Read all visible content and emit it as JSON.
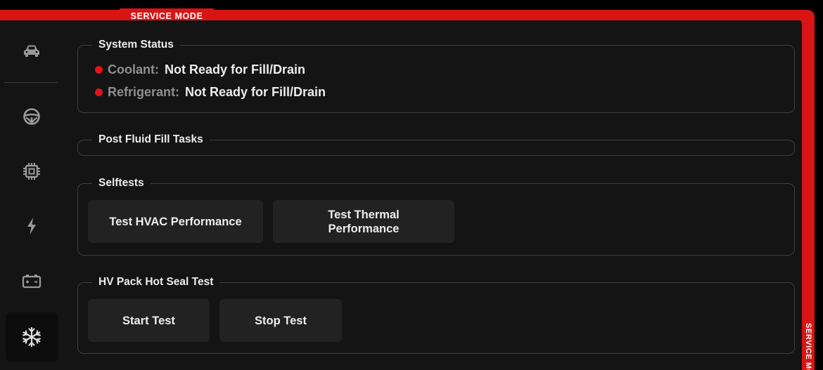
{
  "header": {
    "service_mode_label": "SERVICE MODE",
    "vertical_label": "SERVICE MODE"
  },
  "sidebar": {
    "items": [
      {
        "icon": "car-icon"
      },
      {
        "icon": "steering-wheel-icon"
      },
      {
        "icon": "chip-icon"
      },
      {
        "icon": "lightning-bolt-icon"
      },
      {
        "icon": "battery-icon"
      },
      {
        "icon": "snowflake-icon",
        "active": true
      }
    ]
  },
  "system_status": {
    "title": "System Status",
    "rows": [
      {
        "label": "Coolant:",
        "value": "Not Ready for Fill/Drain",
        "status_color": "#e0141a"
      },
      {
        "label": "Refrigerant:",
        "value": "Not Ready for Fill/Drain",
        "status_color": "#e0141a"
      }
    ]
  },
  "post_fluid_fill": {
    "title": "Post Fluid Fill Tasks"
  },
  "selftests": {
    "title": "Selftests",
    "buttons": [
      {
        "label": "Test HVAC Performance"
      },
      {
        "label": "Test Thermal Performance"
      }
    ]
  },
  "hv_pack": {
    "title": "HV Pack Hot Seal Test",
    "buttons": [
      {
        "label": "Start Test"
      },
      {
        "label": "Stop Test"
      }
    ]
  },
  "colors": {
    "accent_red": "#d81414",
    "background": "#141414",
    "button": "#222222"
  }
}
